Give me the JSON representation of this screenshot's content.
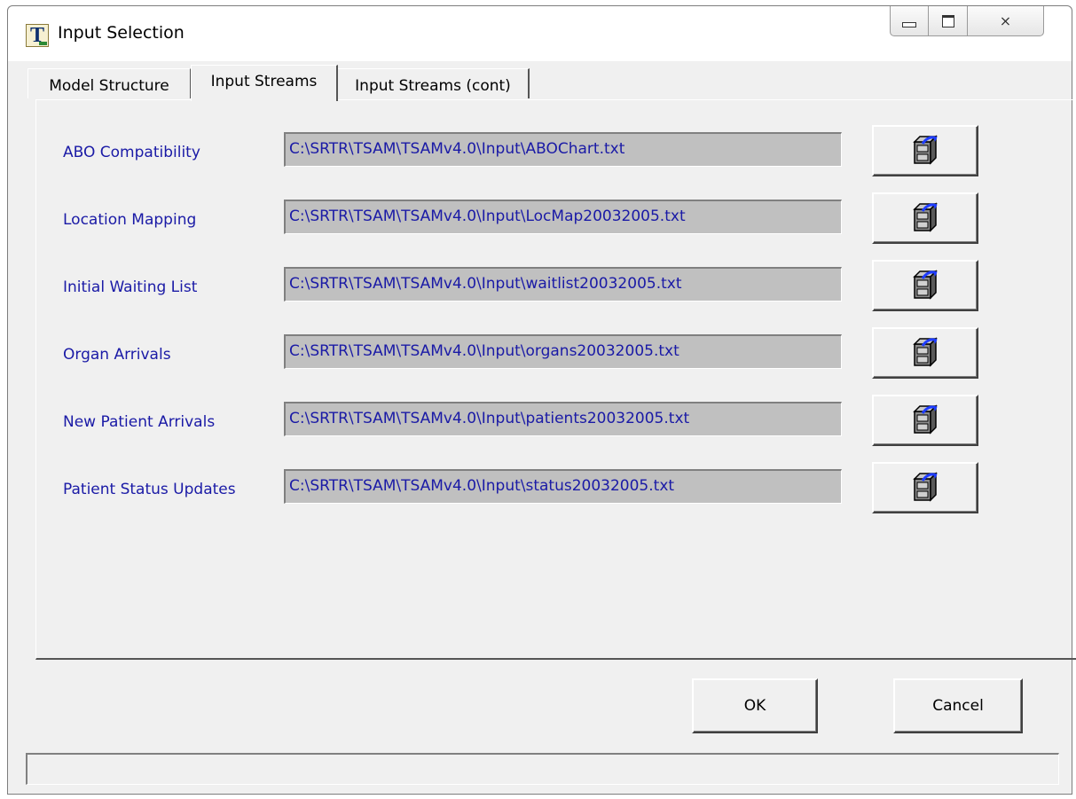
{
  "window": {
    "title": "Input Selection",
    "app_icon_letter": "T",
    "controls": {
      "minimize_icon": "minimize-icon",
      "maximize_icon": "maximize-icon",
      "close_icon": "close-icon",
      "close_glyph": "⨯"
    }
  },
  "tabs": [
    {
      "label": "Model Structure",
      "active": false
    },
    {
      "label": "Input Streams",
      "active": true
    },
    {
      "label": "Input Streams (cont)",
      "active": false
    }
  ],
  "rows": [
    {
      "label": "ABO Compatibility",
      "path": "C:\\SRTR\\TSAM\\TSAMv4.0\\Input\\ABOChart.txt",
      "button_icon": "file-cabinet-icon"
    },
    {
      "label": "Location Mapping",
      "path": "C:\\SRTR\\TSAM\\TSAMv4.0\\Input\\LocMap20032005.txt",
      "button_icon": "file-cabinet-icon"
    },
    {
      "label": "Initial Waiting List",
      "path": "C:\\SRTR\\TSAM\\TSAMv4.0\\Input\\waitlist20032005.txt",
      "button_icon": "file-cabinet-icon"
    },
    {
      "label": "Organ Arrivals",
      "path": "C:\\SRTR\\TSAM\\TSAMv4.0\\Input\\organs20032005.txt",
      "button_icon": "file-cabinet-icon"
    },
    {
      "label": "New Patient Arrivals",
      "path": "C:\\SRTR\\TSAM\\TSAMv4.0\\Input\\patients20032005.txt",
      "button_icon": "file-cabinet-icon"
    },
    {
      "label": "Patient Status Updates",
      "path": "C:\\SRTR\\TSAM\\TSAMv4.0\\Input\\status20032005.txt",
      "button_icon": "file-cabinet-icon"
    }
  ],
  "buttons": {
    "ok": "OK",
    "cancel": "Cancel"
  },
  "status_text": "",
  "colors": {
    "label_blue": "#1a1aa6",
    "field_gray": "#c0c0c0",
    "dialog_bg": "#f0f0f0",
    "icon_blue": "#1e3cff"
  }
}
